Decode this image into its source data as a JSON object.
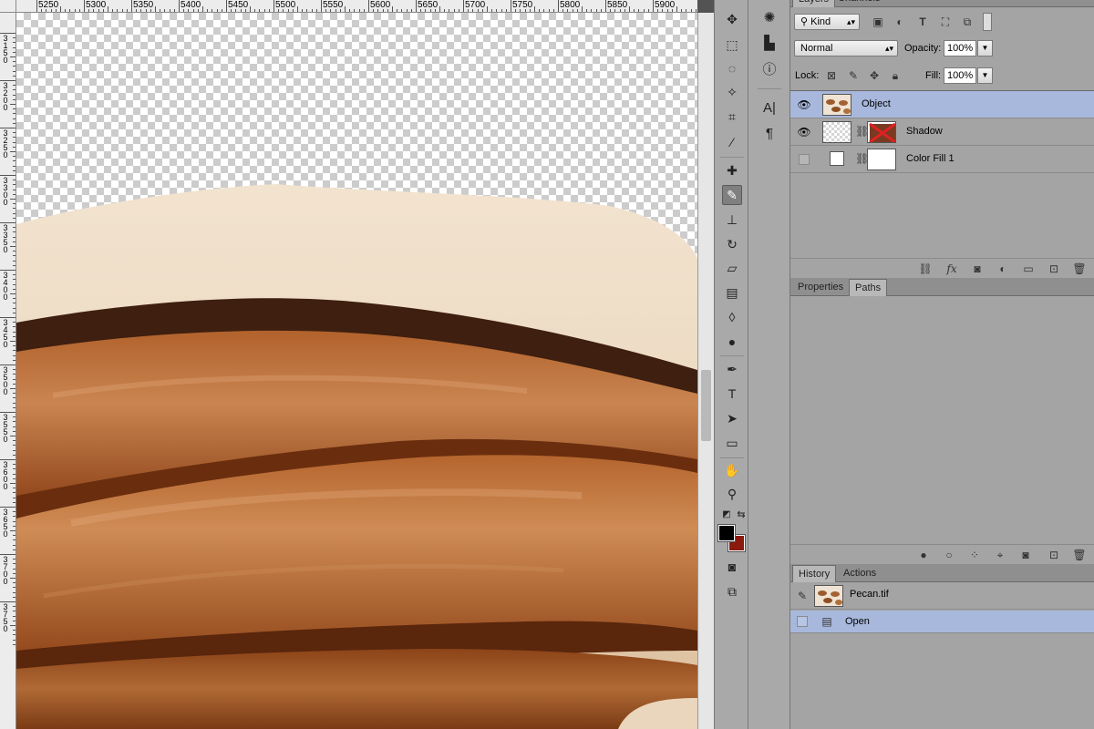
{
  "ruler_top": {
    "labels": [
      "5250",
      "5300",
      "5350",
      "5400",
      "5450",
      "5500",
      "5550",
      "5600",
      "5650",
      "5700",
      "5750",
      "5800",
      "5850",
      "5900"
    ]
  },
  "ruler_left": {
    "labels": [
      "3150",
      "3200",
      "3250",
      "3300",
      "3350",
      "3400",
      "3450",
      "3500",
      "3550",
      "3600",
      "3650",
      "3700",
      "3750"
    ]
  },
  "layers_panel": {
    "tabs": [
      "Layers",
      "Channels"
    ],
    "kind_filter": "Kind",
    "blend_mode": "Normal",
    "opacity_label": "Opacity:",
    "opacity_value": "100%",
    "lock_label": "Lock:",
    "fill_label": "Fill:",
    "fill_value": "100%",
    "layers": [
      {
        "name": "Object",
        "visible": true,
        "selected": true
      },
      {
        "name": "Shadow",
        "visible": true,
        "selected": false
      },
      {
        "name": "Color Fill 1",
        "visible": false,
        "selected": false
      }
    ]
  },
  "properties_panel": {
    "tabs": [
      "Properties",
      "Paths"
    ],
    "active_tab": "Paths"
  },
  "history_panel": {
    "tabs": [
      "History",
      "Actions"
    ],
    "snapshot": "Pecan.tif",
    "states": [
      "Open"
    ]
  },
  "colors": {
    "foreground": "#000000",
    "background": "#8b1a0e",
    "selection": "#a8b8dc"
  },
  "tools": [
    "move-icon",
    "marquee-icon",
    "lasso-icon",
    "quick-select-icon",
    "crop-icon",
    "eyedropper-icon",
    "healing-icon",
    "brush-icon",
    "stamp-icon",
    "history-brush-icon",
    "eraser-icon",
    "gradient-icon",
    "blur-icon",
    "dodge-icon",
    "pen-icon",
    "type-icon",
    "path-select-icon",
    "rectangle-icon",
    "hand-icon",
    "zoom-icon"
  ]
}
